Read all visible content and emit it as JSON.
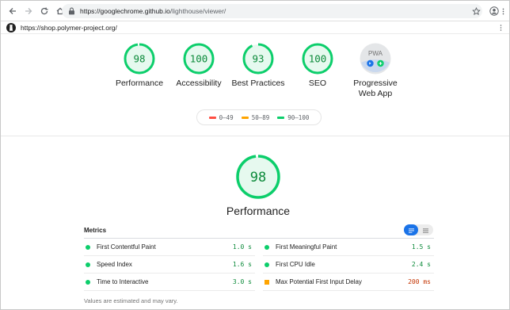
{
  "browser": {
    "url_host": "https://googlechrome.github.io",
    "url_path": "/lighthouse/viewer/"
  },
  "report": {
    "page_url": "https://shop.polymer-project.org/"
  },
  "categories": [
    {
      "label": "Performance",
      "score": "98",
      "value": 0.98
    },
    {
      "label": "Accessibility",
      "score": "100",
      "value": 1.0
    },
    {
      "label": "Best Practices",
      "score": "93",
      "value": 0.93
    },
    {
      "label": "SEO",
      "score": "100",
      "value": 1.0
    },
    {
      "label": "Progressive Web App",
      "badge": "PWA"
    }
  ],
  "legend": [
    {
      "range": "0–49",
      "color": "#ff4e42"
    },
    {
      "range": "50–89",
      "color": "#ffa400"
    },
    {
      "range": "90–100",
      "color": "#0cce6b"
    }
  ],
  "performance": {
    "title": "Performance",
    "score": "98",
    "value": 0.98,
    "metrics_title": "Metrics",
    "metrics": [
      {
        "label": "First Contentful Paint",
        "value": "1.0 s",
        "status": "pass"
      },
      {
        "label": "First Meaningful Paint",
        "value": "1.5 s",
        "status": "pass"
      },
      {
        "label": "Speed Index",
        "value": "1.6 s",
        "status": "pass"
      },
      {
        "label": "First CPU Idle",
        "value": "2.4 s",
        "status": "pass"
      },
      {
        "label": "Time to Interactive",
        "value": "3.0 s",
        "status": "pass"
      },
      {
        "label": "Max Potential First Input Delay",
        "value": "200 ms",
        "status": "average"
      }
    ],
    "footnote": "Values are estimated and may vary."
  },
  "colors": {
    "pass": "#0cce6b",
    "pass_text": "#0c8a3a",
    "pass_fill": "#e6f9ef",
    "average": "#ffa400",
    "accent": "#1a73e8"
  },
  "icons": {
    "back": "arrow-left-icon",
    "forward": "arrow-right-icon",
    "reload": "reload-icon",
    "home": "home-icon",
    "lock": "lock-icon",
    "star": "star-icon",
    "profile": "profile-icon",
    "menu": "kebab-menu-icon"
  }
}
